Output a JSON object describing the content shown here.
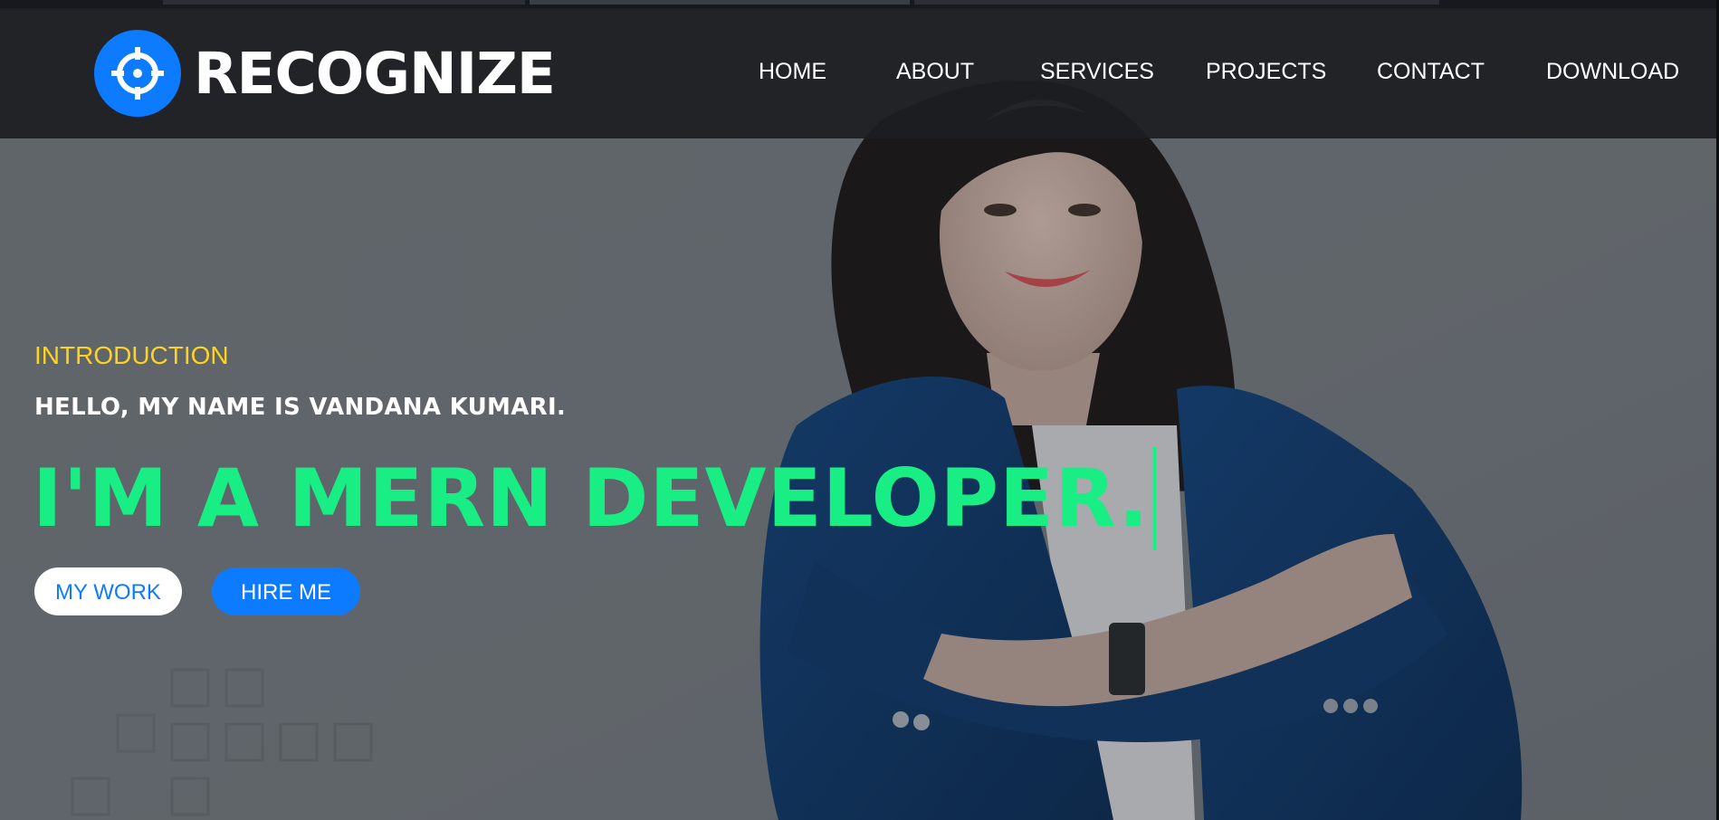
{
  "brand": {
    "name": "RECOGNIZE",
    "logo_icon": "crosshair-icon",
    "logo_color": "#0d7bff"
  },
  "nav": {
    "items": [
      {
        "label": "HOME"
      },
      {
        "label": "ABOUT"
      },
      {
        "label": "SERVICES"
      },
      {
        "label": "PROJECTS"
      },
      {
        "label": "CONTACT"
      },
      {
        "label": "DOWNLOAD"
      }
    ]
  },
  "hero": {
    "intro_label": "INTRODUCTION",
    "greeting": "HELLO, MY NAME IS VANDANA KUMARI.",
    "role_text": "I'M A MERN DEVELOPER.",
    "buttons": {
      "my_work": "MY WORK",
      "hire_me": "HIRE ME"
    }
  },
  "colors": {
    "accent_blue": "#0d7bff",
    "intro_yellow": "#ffd21f",
    "role_green": "#19ee85",
    "header_bg": "#1c1e21"
  }
}
